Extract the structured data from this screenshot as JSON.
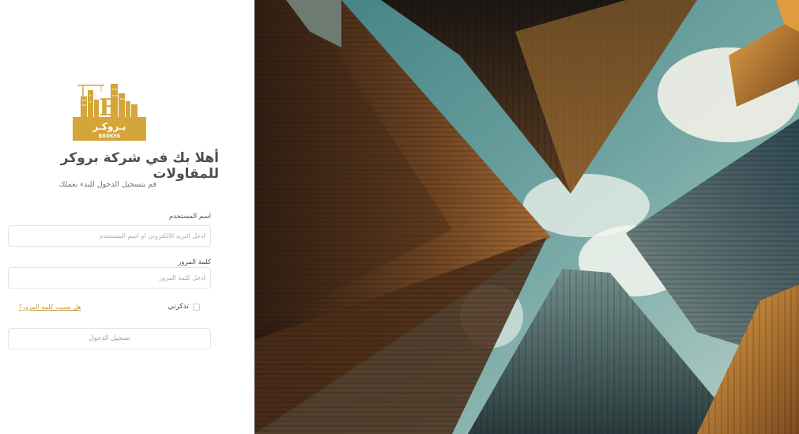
{
  "logo": {
    "arabic_text": "بـروكـر",
    "english_text": "BROKER",
    "color": "#d4a53a"
  },
  "welcome_title": "أهلا بك في شركة بروكر للمقاولات",
  "welcome_subtitle": "قم بتسجيل الدخول للبدء بعملك",
  "form": {
    "username_label": "اسم المستخدم",
    "username_placeholder": "ادخل البريد الالكتروني او اسم المستخدم",
    "username_value": "",
    "password_label": "كلمة المرور",
    "password_placeholder": "ادخل كلمة المرور",
    "password_value": "",
    "remember_label": "تذكرني",
    "remember_checked": false,
    "forgot_label": "هل نسيت كلمة المرور؟",
    "submit_label": "تسجيل الدخول"
  },
  "colors": {
    "accent": "#c49a45",
    "title": "#4a4f57",
    "sky": "#4f8b8a"
  }
}
